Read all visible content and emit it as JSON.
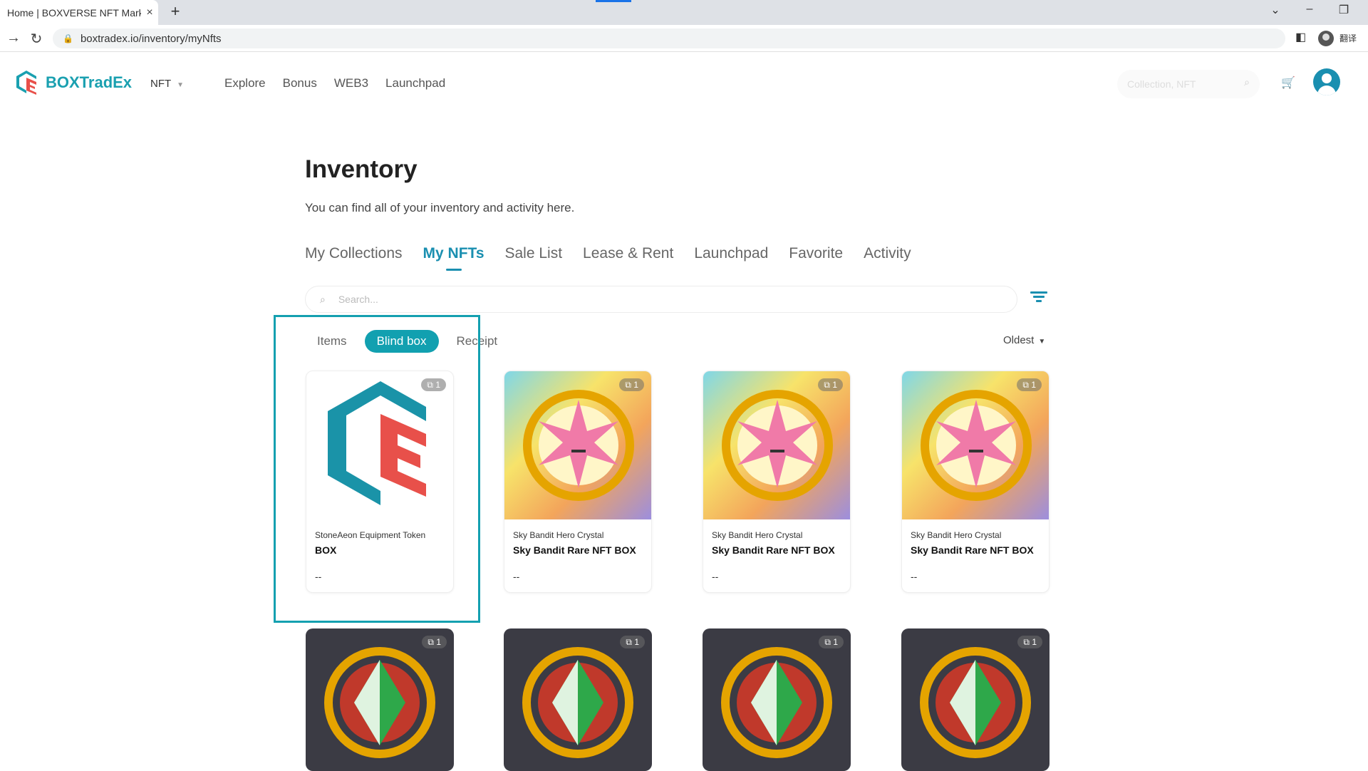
{
  "browser": {
    "tab_title": "Home | BOXVERSE NFT Market",
    "url": "boxtradex.io/inventory/myNfts",
    "translate_label": "翻译"
  },
  "header": {
    "brand": "BOXTradEx",
    "network_select": "NFT",
    "nav": [
      "Explore",
      "Bonus",
      "WEB3",
      "Launchpad"
    ],
    "search_placeholder": "Collection, NFT"
  },
  "page": {
    "title": "Inventory",
    "subtitle": "You can find all of your inventory and activity here."
  },
  "tabs": [
    "My Collections",
    "My NFTs",
    "Sale List",
    "Lease & Rent",
    "Launchpad",
    "Favorite",
    "Activity"
  ],
  "active_tab": "My NFTs",
  "search": {
    "placeholder": "Search..."
  },
  "subtabs": {
    "items": "Items",
    "blind_box": "Blind box",
    "receipt": "Receipt",
    "active": "Blind box"
  },
  "sort": {
    "value": "Oldest"
  },
  "cards": [
    {
      "collection": "StoneAeon Equipment Token",
      "name": "BOX",
      "price": "--",
      "count": "1",
      "art": "boxtradex-logo"
    },
    {
      "collection": "Sky Bandit Hero Crystal",
      "name": "Sky Bandit Rare NFT BOX",
      "price": "--",
      "count": "1",
      "art": "pink-star-crystal"
    },
    {
      "collection": "Sky Bandit Hero Crystal",
      "name": "Sky Bandit Rare NFT BOX",
      "price": "--",
      "count": "1",
      "art": "pink-star-crystal"
    },
    {
      "collection": "Sky Bandit Hero Crystal",
      "name": "Sky Bandit Rare NFT BOX",
      "price": "--",
      "count": "1",
      "art": "pink-star-crystal"
    }
  ],
  "row2_cards": [
    {
      "count": "1",
      "art": "green-diamond-crystal"
    },
    {
      "count": "1",
      "art": "green-diamond-crystal"
    },
    {
      "count": "1",
      "art": "green-diamond-crystal"
    },
    {
      "count": "1",
      "art": "green-diamond-crystal"
    }
  ],
  "colors": {
    "accent": "#1a8fb0",
    "brand": "#1aa0b0",
    "highlight": "#14a0b0"
  }
}
